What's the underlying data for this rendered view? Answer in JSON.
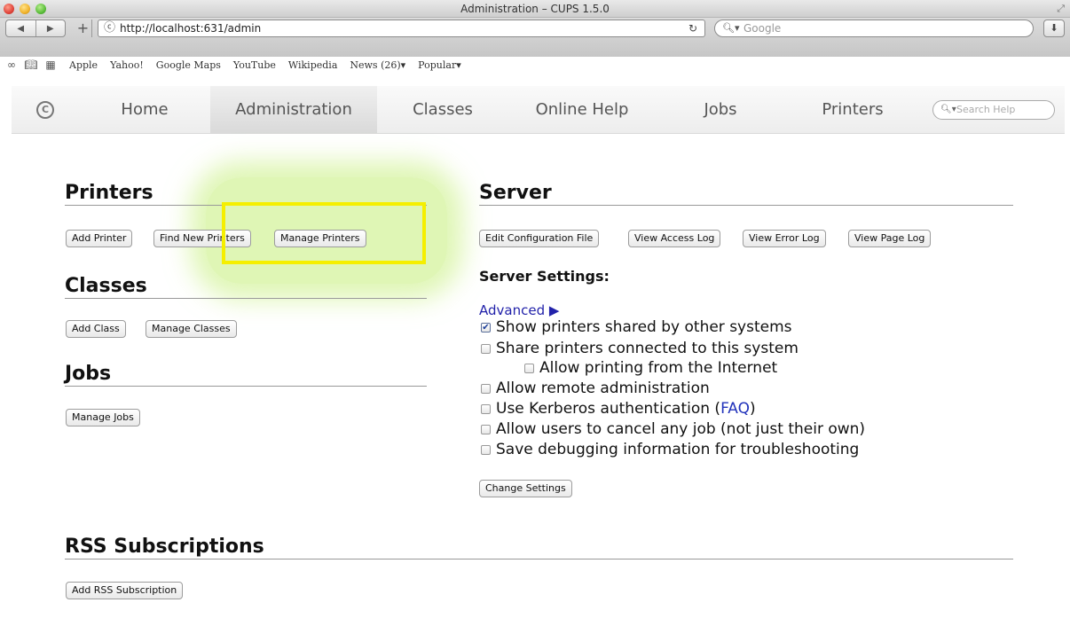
{
  "window": {
    "title": "Administration – CUPS 1.5.0"
  },
  "browser": {
    "url": "http://localhost:631/admin",
    "search_placeholder": "Google",
    "bookmarks": [
      "Apple",
      "Yahoo!",
      "Google Maps",
      "YouTube",
      "Wikipedia",
      "News (26)▾",
      "Popular▾"
    ]
  },
  "cups_nav": {
    "tabs": [
      "Home",
      "Administration",
      "Classes",
      "Online Help",
      "Jobs",
      "Printers"
    ],
    "active_tab": "Administration",
    "search_placeholder": "Search Help"
  },
  "printers": {
    "title": "Printers",
    "buttons": [
      "Add Printer",
      "Find New Printers",
      "Manage Printers"
    ]
  },
  "classes": {
    "title": "Classes",
    "buttons": [
      "Add Class",
      "Manage Classes"
    ]
  },
  "jobs": {
    "title": "Jobs",
    "buttons": [
      "Manage Jobs"
    ]
  },
  "server": {
    "title": "Server",
    "buttons": [
      "Edit Configuration File",
      "View Access Log",
      "View Error Log",
      "View Page Log"
    ],
    "settings_heading": "Server Settings:",
    "advanced_link": "Advanced ▶",
    "options": [
      {
        "label": "Show printers shared by other systems",
        "checked": true
      },
      {
        "label": "Share printers connected to this system",
        "checked": false
      },
      {
        "label": "Allow printing from the Internet",
        "checked": false
      },
      {
        "label": "Allow remote administration",
        "checked": false
      },
      {
        "label": "Use Kerberos authentication (",
        "link": "FAQ",
        "suffix": ")",
        "checked": false
      },
      {
        "label": "Allow users to cancel any job (not just their own)",
        "checked": false
      },
      {
        "label": "Save debugging information for troubleshooting",
        "checked": false
      }
    ],
    "change_button": "Change Settings"
  },
  "rss": {
    "title": "RSS Subscriptions",
    "buttons": [
      "Add RSS Subscription"
    ]
  },
  "colors": {
    "highlight_box": "#f5ef00",
    "highlight_glow": "#c4ee78",
    "link": "#2222aa"
  }
}
